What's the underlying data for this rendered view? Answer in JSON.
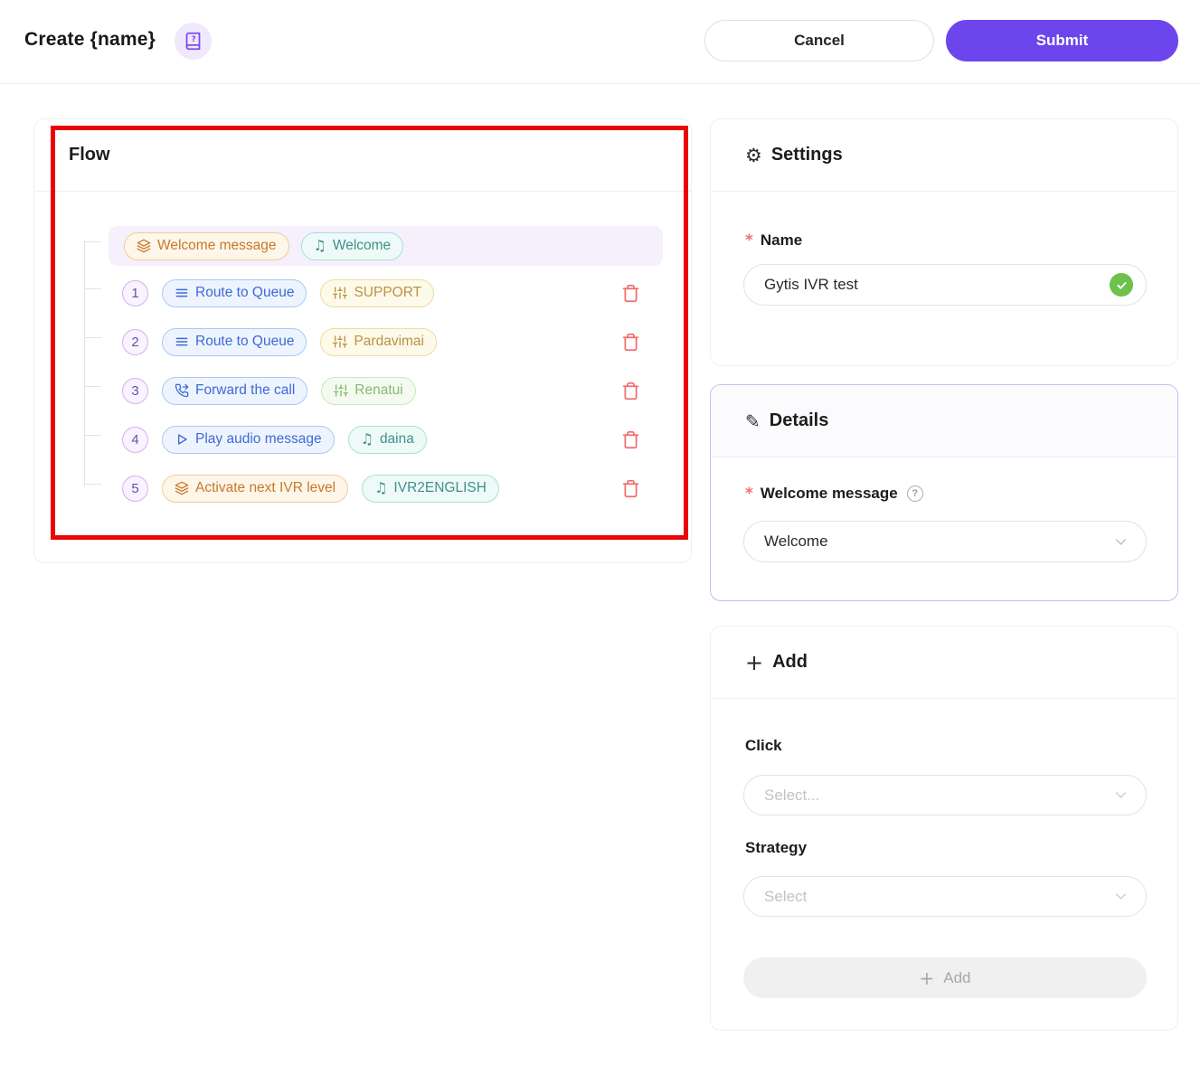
{
  "header": {
    "title": "Create {name}",
    "cancel_label": "Cancel",
    "submit_label": "Submit"
  },
  "flow": {
    "title": "Flow",
    "welcome_row": {
      "action": {
        "label": "Welcome message",
        "icon": "layers-icon"
      },
      "target": {
        "label": "Welcome",
        "icon": "music-note-icon"
      }
    },
    "steps": [
      {
        "number": "1",
        "action": {
          "label": "Route to Queue",
          "icon": "menu-lines-icon"
        },
        "target": {
          "label": "SUPPORT",
          "icon": "sliders-icon"
        }
      },
      {
        "number": "2",
        "action": {
          "label": "Route to Queue",
          "icon": "menu-lines-icon"
        },
        "target": {
          "label": "Pardavimai",
          "icon": "sliders-icon"
        }
      },
      {
        "number": "3",
        "action": {
          "label": "Forward the call",
          "icon": "phone-forward-icon"
        },
        "target": {
          "label": "Renatui",
          "icon": "sliders-icon"
        }
      },
      {
        "number": "4",
        "action": {
          "label": "Play audio message",
          "icon": "play-icon"
        },
        "target": {
          "label": "daina",
          "icon": "music-note-icon"
        }
      },
      {
        "number": "5",
        "action": {
          "label": "Activate next IVR level",
          "icon": "layers-icon"
        },
        "target": {
          "label": "IVR2ENGLISH",
          "icon": "music-note-icon"
        }
      }
    ]
  },
  "settings": {
    "title": "Settings",
    "name_label": "Name",
    "name_value": "Gytis IVR test"
  },
  "details": {
    "title": "Details",
    "welcome_label": "Welcome message",
    "welcome_value": "Welcome"
  },
  "add": {
    "title": "Add",
    "click_label": "Click",
    "click_placeholder": "Select...",
    "strategy_label": "Strategy",
    "strategy_placeholder": "Select",
    "add_button_label": "Add"
  },
  "icons": {
    "music_note_glyph": "♫",
    "gear_glyph": "⚙",
    "pencil_glyph": "✎",
    "plus_glyph": "+",
    "question_glyph": "?",
    "required_glyph": "*"
  },
  "colors": {
    "accent_purple": "#6c46ec",
    "annotation_red": "#ea0505",
    "success_green": "#6cc24a",
    "delete_red": "#f26d6d",
    "highlight_row": "#f6effc",
    "details_border": "#cdb9f1"
  }
}
